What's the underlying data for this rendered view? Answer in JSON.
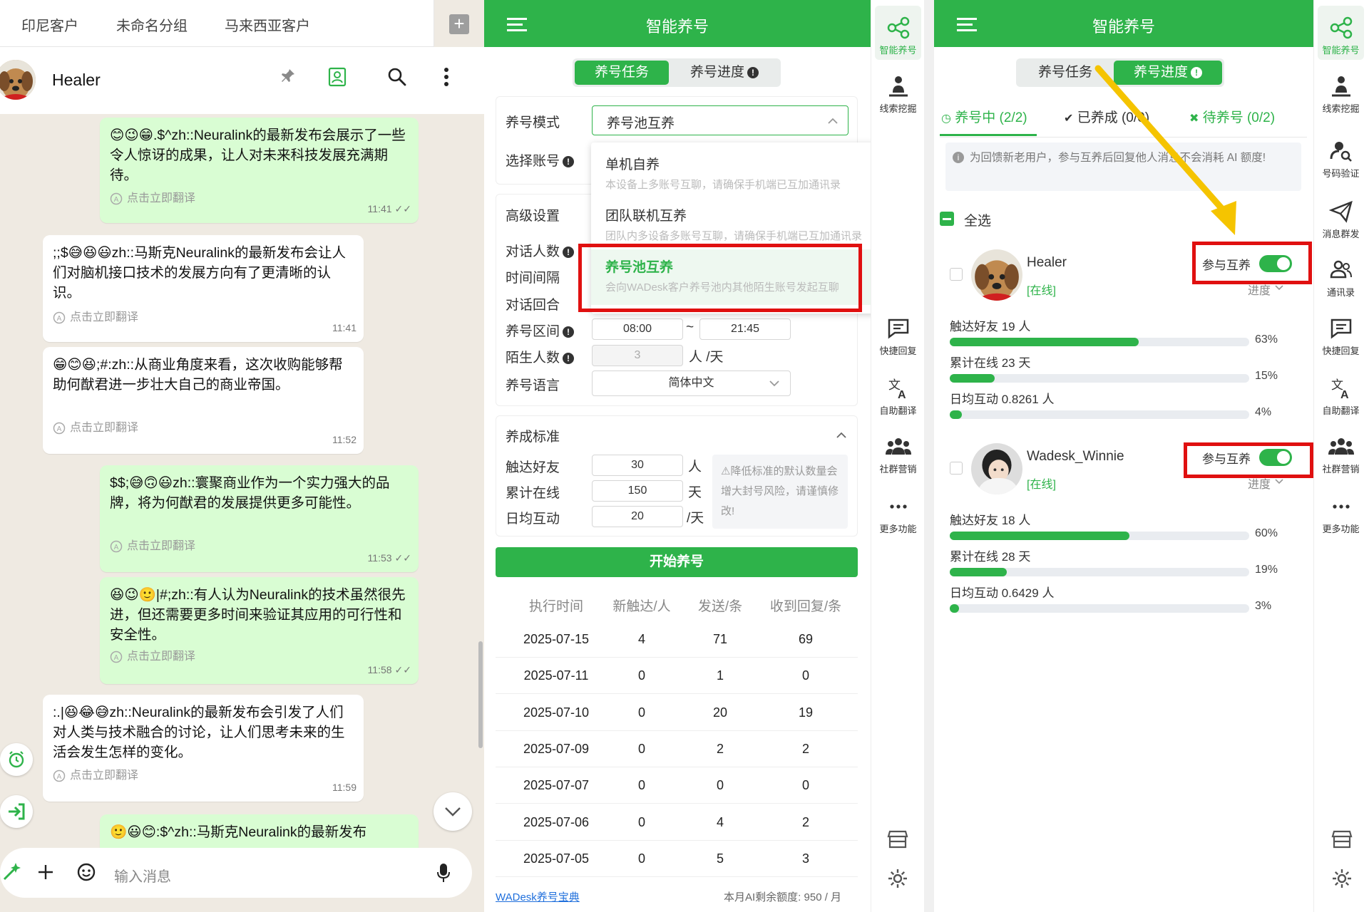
{
  "chat": {
    "tabs": [
      "印尼客户",
      "未命名分组",
      "马来西亚客户"
    ],
    "contact_name": "Healer",
    "translate_label": "点击立即翻译",
    "input_placeholder": "输入消息",
    "messages": [
      {
        "dir": "out",
        "text": "😊😉😁.$^zh::Neuralink的最新发布会展示了一些令人惊讶的成果，让人对未来科技发展充满期待。",
        "time": "11:41"
      },
      {
        "dir": "in",
        "text": ";;$😅😆😃zh::马斯克Neuralink的最新发布会让人们对脑机接口技术的发展方向有了更清晰的认识。",
        "time": "11:41"
      },
      {
        "dir": "in",
        "text": "😁😊😆;#:zh::从商业角度来看，这次收购能够帮助何猷君进一步壮大自己的商业帝国。",
        "time": "11:52"
      },
      {
        "dir": "out",
        "text": "$$;😅🙃😃zh::寰聚商业作为一个实力强大的品牌，将为何猷君的发展提供更多可能性。",
        "time": "11:53"
      },
      {
        "dir": "out",
        "text": "😆😉🙂|#;zh::有人认为Neuralink的技术虽然很先进，但还需要更多时间来验证其应用的可行性和安全性。",
        "time": "11:58"
      },
      {
        "dir": "in",
        "text": ":.|😆😂😅zh::Neuralink的最新发布会引发了人们对人类与技术融合的讨论，让人们思考未来的生活会发生怎样的变化。",
        "time": "11:59"
      },
      {
        "dir": "out",
        "text": "🙂😃😊:$^zh::马斯克Neuralink的最新发布",
        "time": ""
      }
    ]
  },
  "app": {
    "title": "智能养号",
    "seg_tasks": "养号任务",
    "seg_progress": "养号进度"
  },
  "task": {
    "mode_label": "养号模式",
    "mode_value": "养号池互养",
    "account_label": "选择账号",
    "advanced_label": "高级设置",
    "dialog_people_label": "对话人数",
    "interval_label": "时间间隔",
    "rounds_label": "对话回合",
    "range_label": "养号区间",
    "range_start": "08:00",
    "range_sep": "~",
    "range_end": "21:45",
    "stranger_label": "陌生人数",
    "stranger_value": "3",
    "stranger_unit": "人 /天",
    "lang_label": "养号语言",
    "lang_value": "简体中文",
    "standard_title": "养成标准",
    "reach_label": "触达好友",
    "reach_value": "30",
    "reach_unit": "人",
    "online_label": "累计在线",
    "online_value": "150",
    "online_unit": "天",
    "daily_label": "日均互动",
    "daily_value": "20",
    "daily_unit": "/天",
    "tip": "⚠降低标准的默认数量会增大封号风险，请谨慎修改!",
    "start_button": "开始养号",
    "dropdown": [
      {
        "title": "单机自养",
        "desc": "本设备上多账号互聊，请确保手机端已互加通讯录"
      },
      {
        "title": "团队联机互养",
        "desc": "团队内多设备多账号互聊，请确保手机端已互加通讯录"
      },
      {
        "title": "养号池互养",
        "desc": "会向WADesk客户养号池内其他陌生账号发起互聊"
      }
    ],
    "table_headers": [
      "执行时间",
      "新触达/人",
      "发送/条",
      "收到回复/条"
    ],
    "table_rows": [
      [
        "2025-07-15",
        "4",
        "71",
        "69"
      ],
      [
        "2025-07-11",
        "0",
        "1",
        "0"
      ],
      [
        "2025-07-10",
        "0",
        "20",
        "19"
      ],
      [
        "2025-07-09",
        "0",
        "2",
        "2"
      ],
      [
        "2025-07-07",
        "0",
        "0",
        "0"
      ],
      [
        "2025-07-06",
        "0",
        "4",
        "2"
      ],
      [
        "2025-07-05",
        "0",
        "5",
        "3"
      ]
    ],
    "footer_link": "WADesk养号宝典",
    "footer_quota": "本月AI剩余额度: 950 / 月"
  },
  "sidebar": [
    {
      "label": "智能养号",
      "icon": "share-nodes-icon"
    },
    {
      "label": "线索挖掘",
      "icon": "person-dig-icon"
    },
    {
      "label": "号码验证",
      "icon": "user-search-icon"
    },
    {
      "label": "消息群发",
      "icon": "paper-plane-icon"
    },
    {
      "label": "通讯录",
      "icon": "contacts-icon"
    },
    {
      "label": "快捷回复",
      "icon": "message-icon"
    },
    {
      "label": "自助翻译",
      "icon": "translate-icon"
    },
    {
      "label": "社群营销",
      "icon": "group-icon"
    },
    {
      "label": "更多功能",
      "icon": "more-icon"
    }
  ],
  "progress": {
    "tabs": [
      "养号中 (2/2)",
      "已养成 (0/0)",
      "待养号 (0/2)"
    ],
    "notice": "为回馈新老用户，参与互养后回复他人消息不会消耗 AI 额度!",
    "select_all": "全选",
    "join_label": "参与互养",
    "status_online": "[在线]",
    "progress_label": "进度",
    "accounts": [
      {
        "name": "Healer",
        "metrics": [
          {
            "label": "触达好友 19 人",
            "pct": 63,
            "pct_text": "63%"
          },
          {
            "label": "累计在线 23 天",
            "pct": 15,
            "pct_text": "15%"
          },
          {
            "label": "日均互动 0.8261 人",
            "pct": 4,
            "pct_text": "4%"
          }
        ]
      },
      {
        "name": "Wadesk_Winnie",
        "metrics": [
          {
            "label": "触达好友 18 人",
            "pct": 60,
            "pct_text": "60%"
          },
          {
            "label": "累计在线 28 天",
            "pct": 19,
            "pct_text": "19%"
          },
          {
            "label": "日均互动 0.6429 人",
            "pct": 3,
            "pct_text": "3%"
          }
        ]
      }
    ]
  },
  "colors": {
    "brand_green": "#2eb34a",
    "highlight_red": "#e01010",
    "arrow_yellow": "#f5c400",
    "chat_out": "#d9fdd3"
  }
}
